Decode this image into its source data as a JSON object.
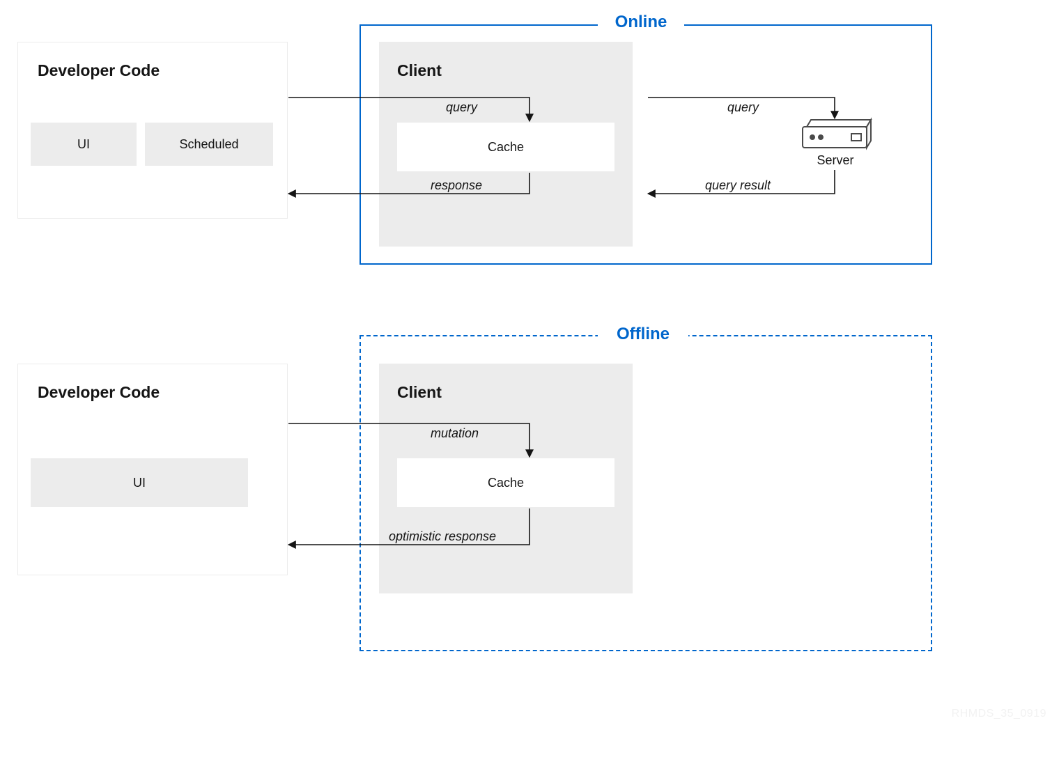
{
  "online": {
    "mode_label": "Online",
    "dev_title": "Developer Code",
    "dev_chips": {
      "ui": "UI",
      "scheduled": "Scheduled"
    },
    "client_title": "Client",
    "cache_label": "Cache",
    "server_label": "Server",
    "arrows": {
      "query_to_cache": "query",
      "query_to_server": "query",
      "response_to_dev": "response",
      "result_to_client": "query result"
    }
  },
  "offline": {
    "mode_label": "Offline",
    "dev_title": "Developer Code",
    "dev_ui": "UI",
    "client_title": "Client",
    "cache_label": "Cache",
    "arrows": {
      "mutation": "mutation",
      "optimistic": "optimistic response"
    }
  },
  "watermark": "RHMDS_35_0919",
  "colors": {
    "accent": "#0066cc",
    "panel": "#ececec",
    "line": "#151515"
  }
}
